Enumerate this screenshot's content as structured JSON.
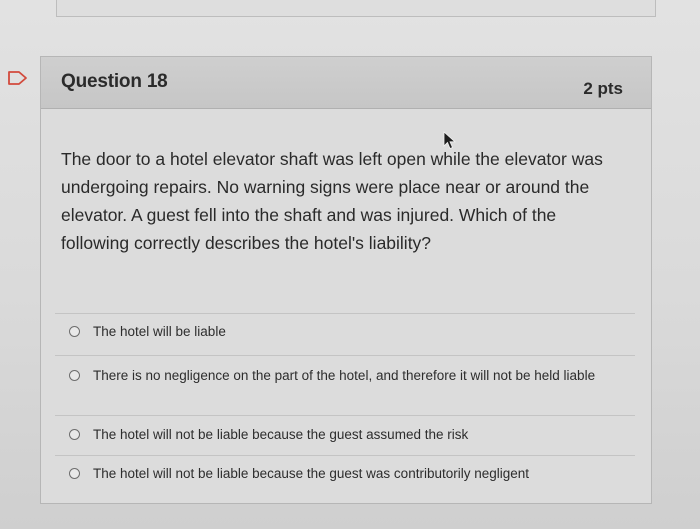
{
  "question": {
    "title": "Question 18",
    "points": "2 pts",
    "text": "The door to a hotel elevator shaft was left open while the elevator was undergoing repairs. No warning signs were place near or around the elevator. A guest fell into the shaft and was injured. Which of the following correctly describes the hotel's liability?",
    "answers": [
      {
        "label": "The hotel will be liable",
        "selected": false
      },
      {
        "label": "There is no negligence on the part of the hotel, and therefore it will not be held liable",
        "selected": false
      },
      {
        "label": "The hotel will not be liable because the guest assumed the risk",
        "selected": false
      },
      {
        "label": "The hotel will not be liable because the guest was contributorily negligent",
        "selected": false
      }
    ]
  },
  "icons": {
    "flag": "flag-icon",
    "cursor": "mouse-pointer-icon",
    "radio": "radio-unchecked-icon"
  },
  "colors": {
    "header_bg": "#c9c9c9",
    "card_bg": "#dcdcdc",
    "flag_stroke": "#d24a3c",
    "text": "#2a2a2a"
  }
}
